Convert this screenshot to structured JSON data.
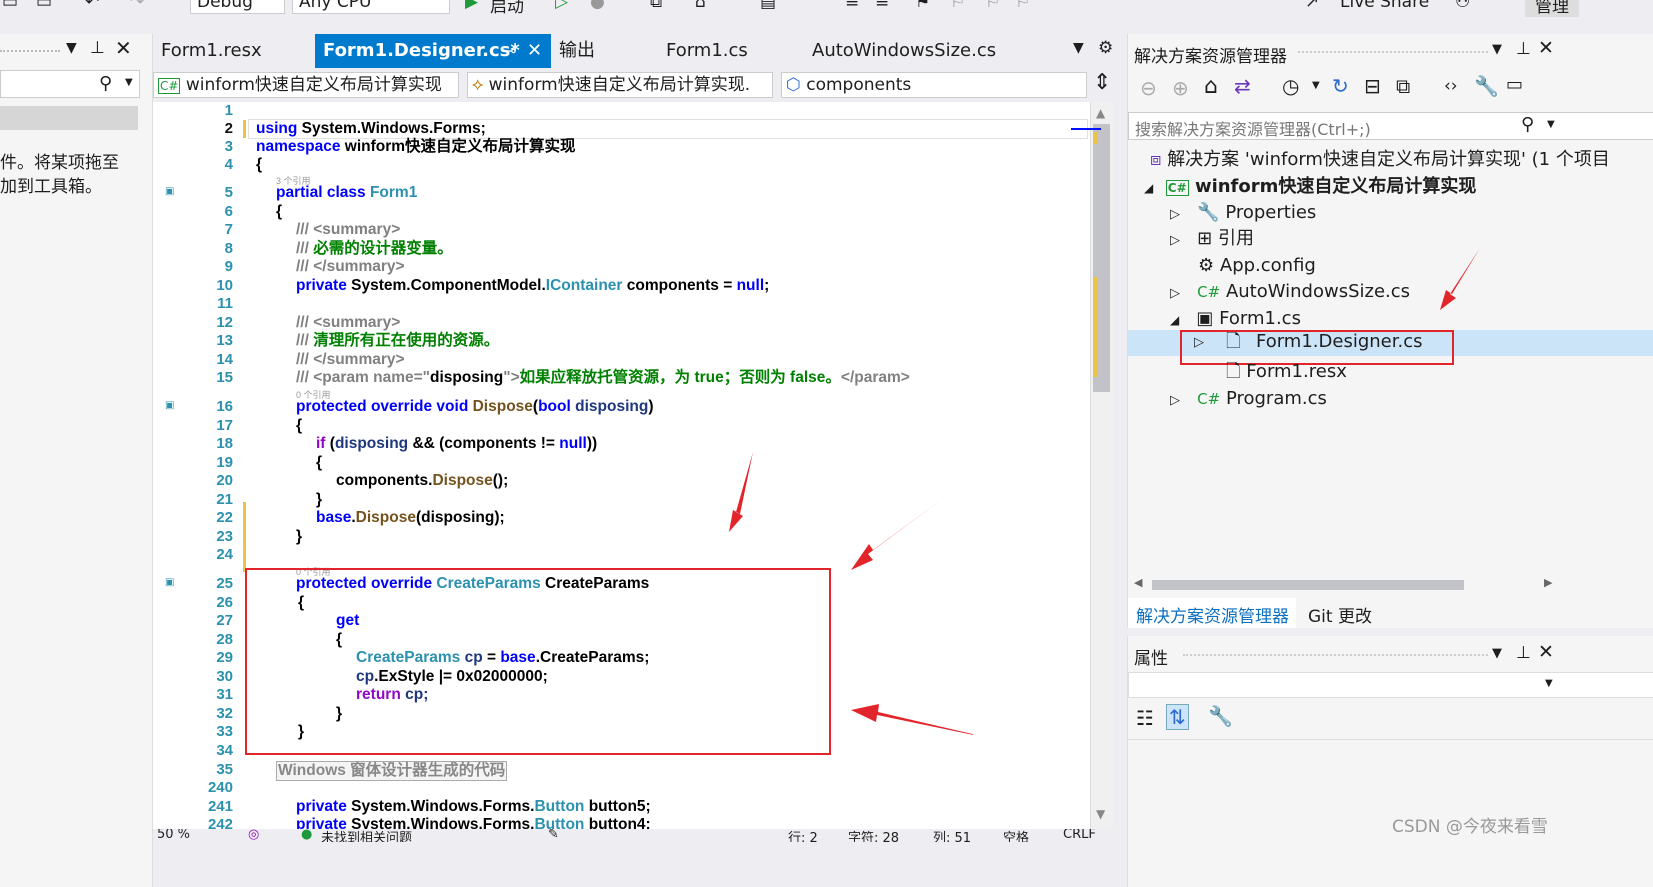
{
  "toolbar": {
    "config": "Debug",
    "platform": "Any CPU",
    "start_label": "启动",
    "live_share": "Live Share",
    "admin": "管理"
  },
  "toolbox": {
    "hint_line1": "件。将某项拖至",
    "hint_line2": "加到工具箱。"
  },
  "tabs": [
    {
      "label": "Form1.resx"
    },
    {
      "label": "Form1.Designer.cs*"
    },
    {
      "label": "输出"
    },
    {
      "label": "Form1.cs"
    },
    {
      "label": "AutoWindowsSize.cs"
    }
  ],
  "navbar": {
    "project": "winform快速自定义布局计算实现",
    "class": "winform快速自定义布局计算实现.",
    "member": "components"
  },
  "code": {
    "ref3": "3 个引用",
    "ref0": "0 个引用",
    "lines": {
      "l1": "1",
      "l2": "2",
      "l3": "3",
      "l4": "4",
      "l5": "5",
      "l6": "6",
      "l7": "7",
      "l8": "8",
      "l9": "9",
      "l10": "10",
      "l11": "11",
      "l12": "12",
      "l13": "13",
      "l14": "14",
      "l15": "15",
      "l16": "16",
      "l17": "17",
      "l18": "18",
      "l19": "19",
      "l20": "20",
      "l21": "21",
      "l22": "22",
      "l23": "23",
      "l24": "24",
      "l25": "25",
      "l26": "26",
      "l27": "27",
      "l28": "28",
      "l29": "29",
      "l30": "30",
      "l31": "31",
      "l32": "32",
      "l33": "33",
      "l34": "34",
      "l35": "35",
      "l240": "240",
      "l241": "241",
      "l242": "242"
    },
    "t": {
      "using": "using",
      "ns_winforms": "System.Windows.Forms;",
      "namespace": "namespace",
      "ns_name": "winform快速自定义布局计算实现",
      "lbrace": "{",
      "rbrace": "}",
      "partial": "partial",
      "class": "class",
      "form1": "Form1",
      "summary_open": "/// <summary>",
      "summary_close": "/// </summary>",
      "doc_slash": "/// ",
      "doc1": "必需的设计器变量。",
      "private": "private",
      "sys_cm": "System.ComponentModel.",
      "icontainer": "IContainer",
      "components_eq": " components = ",
      "null": "null",
      "semi": ";",
      "doc2": "清理所有正在使用的资源。",
      "param_open": "<param name=\"",
      "param_name": "disposing",
      "param_mid": "\">",
      "param_text1": "如果应释放托管资源，为 ",
      "true": "true",
      "param_text2": "；否则为 ",
      "false": "false",
      "param_text3": "。",
      "param_close": "</param>",
      "protected": "protected",
      "override": "override",
      "void": "void",
      "dispose": "Dispose",
      "bool": "bool",
      "disposing": "disposing",
      "if": "if",
      "and_components": " && (components != ",
      "close2": "))",
      "components_dot": "components.",
      "call_end": "();",
      "base": "base",
      "dot": ".",
      "paren_disposing": "(disposing);",
      "createparams": "CreateParams",
      "get": "get",
      "cp": "cp",
      "eq_base": " = ",
      "dot_cp": ".CreateParams;",
      "exstyle": ".ExStyle |= 0x02000000;",
      "return": "return",
      "cp_semi": " cp;",
      "region": "Windows 窗体设计器生成的代码",
      "swf": "System.Windows.Forms.",
      "button": "Button",
      "button5": " button5;",
      "button4": " button4;"
    }
  },
  "status": {
    "zoom": "50 %",
    "issues": "未找到相关问题",
    "line": "行: 2",
    "char": "字符: 28",
    "col": "列: 51",
    "spaces": "空格",
    "crlf": "CRLF"
  },
  "solution": {
    "title": "解决方案资源管理器",
    "search_placeholder": "搜索解决方案资源管理器(Ctrl+;)",
    "items": [
      {
        "label": "解决方案 'winform快速自定义布局计算实现' (1 个项目"
      },
      {
        "label": "winform快速自定义布局计算实现"
      },
      {
        "label": "Properties"
      },
      {
        "label": "引用"
      },
      {
        "label": "App.config"
      },
      {
        "label": "AutoWindowsSize.cs"
      },
      {
        "label": "Form1.cs"
      },
      {
        "label": "Form1.Designer.cs"
      },
      {
        "label": "Form1.resx"
      },
      {
        "label": "Program.cs"
      }
    ],
    "tab_solution": "解决方案资源管理器",
    "tab_git": "Git 更改"
  },
  "properties": {
    "title": "属性"
  },
  "watermark": "CSDN @今夜来看雪",
  "colors": {
    "accent": "#007acc",
    "highlight": "#e2252b"
  }
}
